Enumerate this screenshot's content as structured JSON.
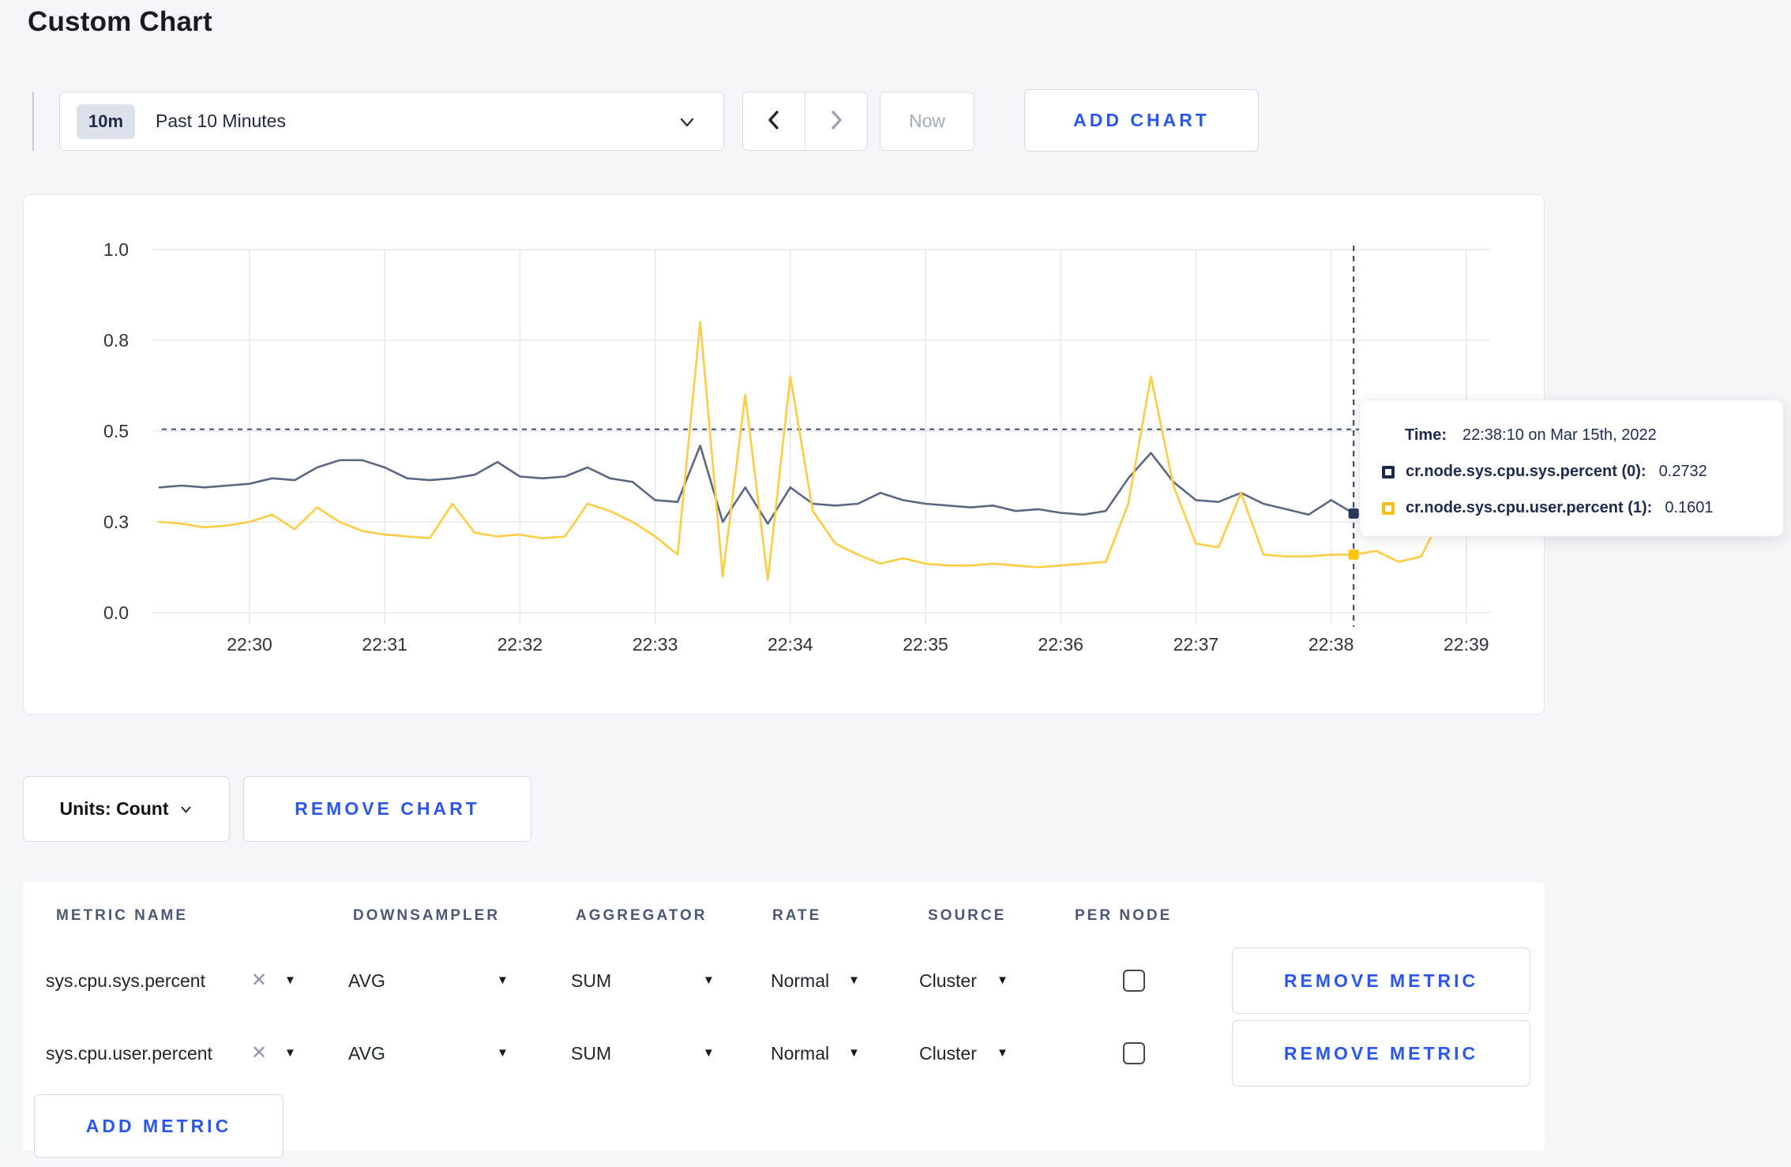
{
  "page": {
    "title": "Custom Chart"
  },
  "toolbar": {
    "range_badge": "10m",
    "range_label": "Past 10 Minutes",
    "now_label": "Now",
    "add_chart_label": "ADD CHART"
  },
  "icons": {
    "caret_down": "▼",
    "close": "✕"
  },
  "chart_footer": {
    "units_label": "Units: Count",
    "remove_chart_label": "REMOVE CHART"
  },
  "tooltip": {
    "time_label": "Time:",
    "time_value": "22:38:10 on Mar 15th, 2022",
    "rows": [
      {
        "swatch": "#1c2a4a",
        "label": "cr.node.sys.cpu.sys.percent (0):",
        "value": "0.2732"
      },
      {
        "swatch": "#f7be16",
        "label": "cr.node.sys.cpu.user.percent (1):",
        "value": "0.1601"
      }
    ]
  },
  "chart_data": {
    "type": "line",
    "title": "",
    "xlabel": "",
    "ylabel": "",
    "ylim": [
      0,
      1.0
    ],
    "grid": true,
    "x_tick_labels": [
      "22:30",
      "22:31",
      "22:32",
      "22:33",
      "22:34",
      "22:35",
      "22:36",
      "22:37",
      "22:38",
      "22:39"
    ],
    "x_tick_minutes": [
      0,
      1,
      2,
      3,
      4,
      5,
      6,
      7,
      8,
      9
    ],
    "y_ticks": [
      {
        "label": "0.0",
        "value": 0
      },
      {
        "label": "0.3",
        "value": 0.25
      },
      {
        "label": "0.5",
        "value": 0.5
      },
      {
        "label": "0.8",
        "value": 0.75
      },
      {
        "label": "1.0",
        "value": 1.0
      }
    ],
    "sample_start_minute": -0.6667,
    "sample_step_minutes": 0.16667,
    "series": [
      {
        "name": "cr.node.sys.cpu.sys.percent (0)",
        "color": "#5a6882",
        "values": [
          0.345,
          0.35,
          0.345,
          0.35,
          0.355,
          0.37,
          0.365,
          0.4,
          0.42,
          0.42,
          0.4,
          0.37,
          0.365,
          0.37,
          0.38,
          0.415,
          0.375,
          0.37,
          0.375,
          0.4,
          0.37,
          0.36,
          0.31,
          0.305,
          0.46,
          0.25,
          0.345,
          0.245,
          0.345,
          0.3,
          0.295,
          0.3,
          0.33,
          0.31,
          0.3,
          0.295,
          0.29,
          0.295,
          0.28,
          0.285,
          0.275,
          0.27,
          0.28,
          0.37,
          0.44,
          0.36,
          0.31,
          0.305,
          0.33,
          0.3,
          0.285,
          0.27,
          0.31,
          0.2732,
          0.26,
          0.27,
          0.3,
          0.31,
          0.3,
          0.295
        ]
      },
      {
        "name": "cr.node.sys.cpu.user.percent (1)",
        "color": "#ffcd44",
        "values": [
          0.25,
          0.245,
          0.235,
          0.24,
          0.25,
          0.27,
          0.23,
          0.29,
          0.25,
          0.225,
          0.215,
          0.21,
          0.205,
          0.3,
          0.22,
          0.21,
          0.215,
          0.205,
          0.21,
          0.3,
          0.28,
          0.25,
          0.21,
          0.16,
          0.8,
          0.1,
          0.6,
          0.09,
          0.65,
          0.28,
          0.19,
          0.16,
          0.135,
          0.15,
          0.135,
          0.13,
          0.13,
          0.135,
          0.13,
          0.125,
          0.13,
          0.135,
          0.14,
          0.3,
          0.65,
          0.35,
          0.19,
          0.18,
          0.33,
          0.16,
          0.155,
          0.155,
          0.16,
          0.1601,
          0.17,
          0.14,
          0.155,
          0.28,
          0.22,
          0.27
        ]
      }
    ],
    "crosshair": {
      "minute": 8.1667,
      "h_value": 0.505,
      "points": [
        {
          "value": 0.2732,
          "color": "#2c3a5c"
        },
        {
          "value": 0.1601,
          "color": "#ffc40e"
        }
      ]
    },
    "colors": {
      "grid": "#e8e9ec",
      "axis_text": "#2e343c",
      "crosshair": "#3f5175"
    }
  },
  "metrics_table": {
    "headers": [
      "METRIC NAME",
      "DOWNSAMPLER",
      "AGGREGATOR",
      "RATE",
      "SOURCE",
      "PER NODE"
    ],
    "rows": [
      {
        "metric": "sys.cpu.sys.percent",
        "downsampler": "AVG",
        "aggregator": "SUM",
        "rate": "Normal",
        "source": "Cluster",
        "per_node_checked": false,
        "remove_label": "REMOVE METRIC"
      },
      {
        "metric": "sys.cpu.user.percent",
        "downsampler": "AVG",
        "aggregator": "SUM",
        "rate": "Normal",
        "source": "Cluster",
        "per_node_checked": false,
        "remove_label": "REMOVE METRIC"
      }
    ],
    "add_metric_label": "ADD METRIC"
  }
}
